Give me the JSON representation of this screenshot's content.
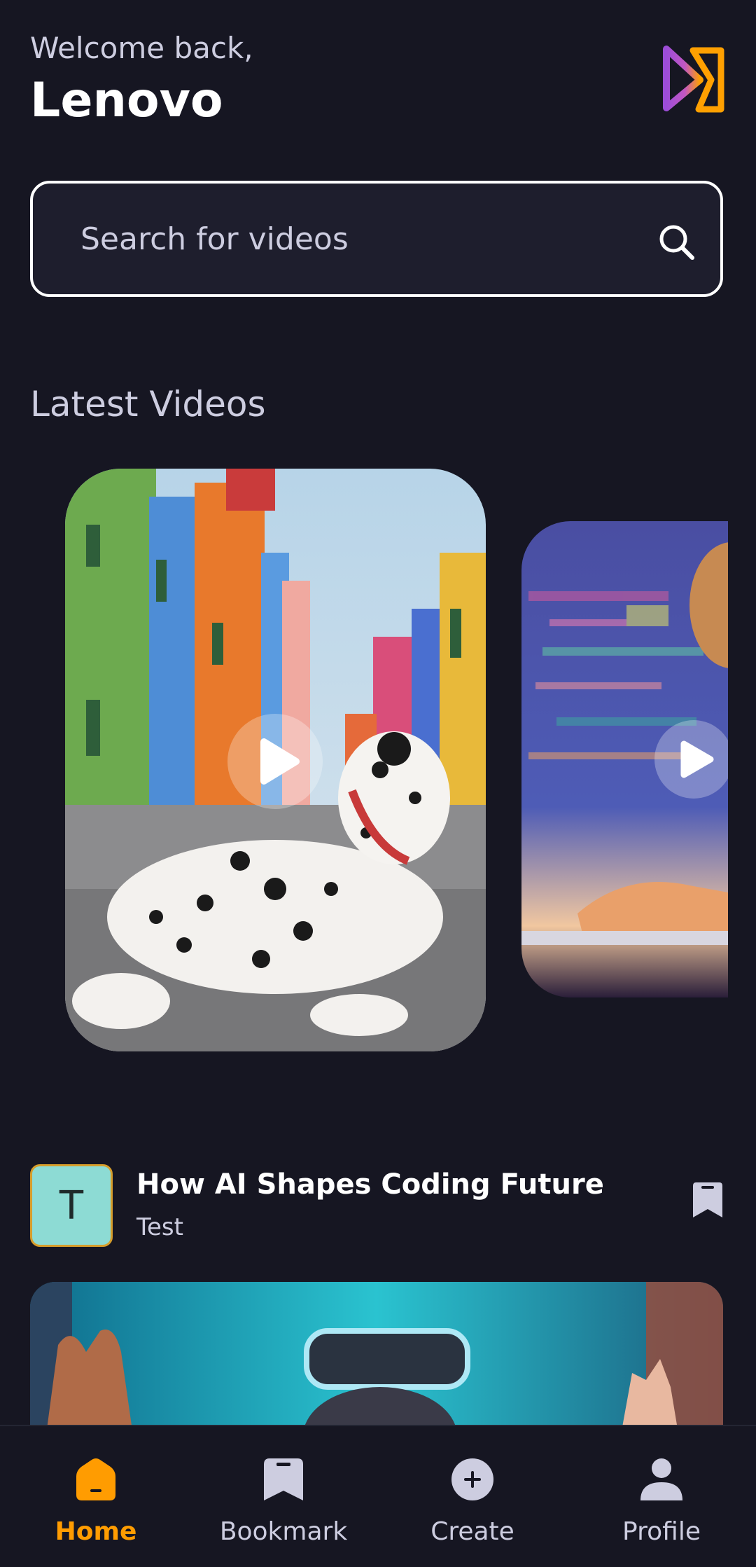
{
  "header": {
    "welcome": "Welcome back,",
    "username": "Lenovo"
  },
  "search": {
    "placeholder": "Search for videos"
  },
  "latest": {
    "title": "Latest Videos"
  },
  "post": {
    "avatar_letter": "T",
    "title": "How AI Shapes Coding Future",
    "creator": "Test"
  },
  "tabs": [
    {
      "label": "Home",
      "icon": "home-icon",
      "active": true
    },
    {
      "label": "Bookmark",
      "icon": "bookmark-icon",
      "active": false
    },
    {
      "label": "Create",
      "icon": "plus-icon",
      "active": false
    },
    {
      "label": "Profile",
      "icon": "profile-icon",
      "active": false
    }
  ],
  "colors": {
    "background": "#161622",
    "accent": "#FF9C01",
    "text_muted": "#CDCDE0",
    "surface": "#1E1E2D"
  }
}
